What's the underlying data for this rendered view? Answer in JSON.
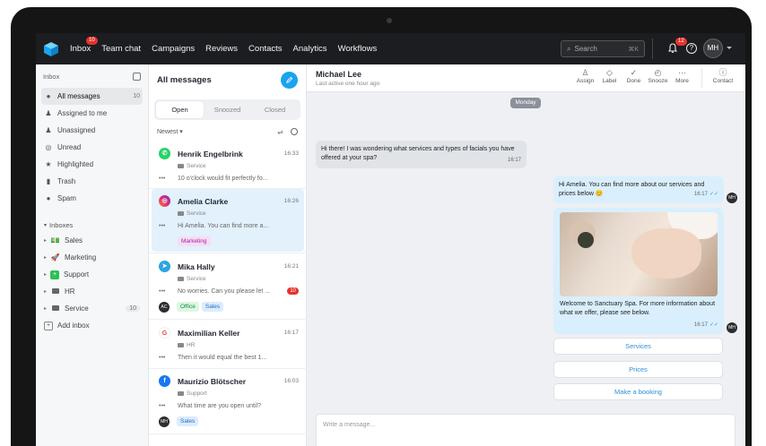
{
  "nav": {
    "items": [
      {
        "label": "Inbox",
        "badge": "10"
      },
      {
        "label": "Team chat"
      },
      {
        "label": "Campaigns"
      },
      {
        "label": "Reviews"
      },
      {
        "label": "Contacts"
      },
      {
        "label": "Analytics"
      },
      {
        "label": "Workflows"
      }
    ],
    "search_placeholder": "Search",
    "search_shortcut": "⌘K",
    "notification_badge": "12",
    "user_initials": "MH"
  },
  "sidebar": {
    "header": "Inbox",
    "items": [
      {
        "label": "All messages",
        "count": "10",
        "icon": "chat-icon"
      },
      {
        "label": "Assigned to me",
        "icon": "user-icon"
      },
      {
        "label": "Unassigned",
        "icon": "user-off-icon"
      },
      {
        "label": "Unread",
        "icon": "eye-off-icon"
      },
      {
        "label": "Highlighted",
        "icon": "star-icon"
      },
      {
        "label": "Trash",
        "icon": "trash-icon"
      },
      {
        "label": "Spam",
        "icon": "spam-icon"
      }
    ],
    "inboxes_label": "Inboxes",
    "inboxes": [
      {
        "label": "Sales",
        "icon": "💵"
      },
      {
        "label": "Marketing",
        "icon": "🚀"
      },
      {
        "label": "Support",
        "icon": "➕"
      },
      {
        "label": "HR",
        "icon": "folder"
      },
      {
        "label": "Service",
        "icon": "folder",
        "count": "10"
      }
    ],
    "add_inbox": "Add inbox"
  },
  "list": {
    "title": "All messages",
    "tabs": [
      "Open",
      "Snoozed",
      "Closed"
    ],
    "sort": "Newest ▾",
    "conversations": [
      {
        "name": "Henrik Engelbrink",
        "time": "16:33",
        "inbox": "Service",
        "preview": "10 o'clock would fit perfectly fo...",
        "channel": "whatsapp",
        "color": "#25d366"
      },
      {
        "name": "Amelia Clarke",
        "time": "16:26",
        "inbox": "Service",
        "preview": "Hi Amelia. You can find more a...",
        "channel": "instagram",
        "color": "#dd2a7b",
        "tag": "Marketing"
      },
      {
        "name": "Mika Hally",
        "time": "16:21",
        "inbox": "Service",
        "preview": "No worries. Can you please let ...",
        "channel": "telegram",
        "color": "#2aa4e0",
        "unread": "10",
        "avatar": "AC",
        "tags": [
          "Office",
          "Sales"
        ]
      },
      {
        "name": "Maximilian Keller",
        "time": "16:17",
        "inbox": "HR",
        "preview": "Then it would equal the best 1...",
        "channel": "google",
        "color": "#ffffff"
      },
      {
        "name": "Maurizio Blötscher",
        "time": "16:03",
        "inbox": "Support",
        "preview": "What time are you open until?",
        "channel": "facebook",
        "color": "#1877f2",
        "avatar": "MH",
        "tags": [
          "Sales"
        ]
      }
    ]
  },
  "chat": {
    "contact_name": "Michael Lee",
    "status": "Last active one hour ago",
    "actions": [
      {
        "label": "Assign",
        "icon": "assign-icon"
      },
      {
        "label": "Label",
        "icon": "label-icon"
      },
      {
        "label": "Done",
        "icon": "check-icon"
      },
      {
        "label": "Snooze",
        "icon": "snooze-icon"
      },
      {
        "label": "More",
        "icon": "more-icon"
      }
    ],
    "contact_action": "Contact",
    "day": "Monday",
    "incoming": {
      "text": "Hi there! I was wondering what services and types of facials you have offered at your spa?",
      "time": "16:17"
    },
    "outgoing1": {
      "text": "Hi Amelia. You can find more about our services and prices below 😊",
      "time": "16:17"
    },
    "outgoing2": {
      "text": "Welcome to Sanctuary Spa. For more information about what we offer, please see below.",
      "time": "16:17"
    },
    "agent_initials": "MH",
    "quick_replies": [
      "Services",
      "Prices",
      "Make a booking"
    ],
    "composer_placeholder": "Write a message..."
  }
}
